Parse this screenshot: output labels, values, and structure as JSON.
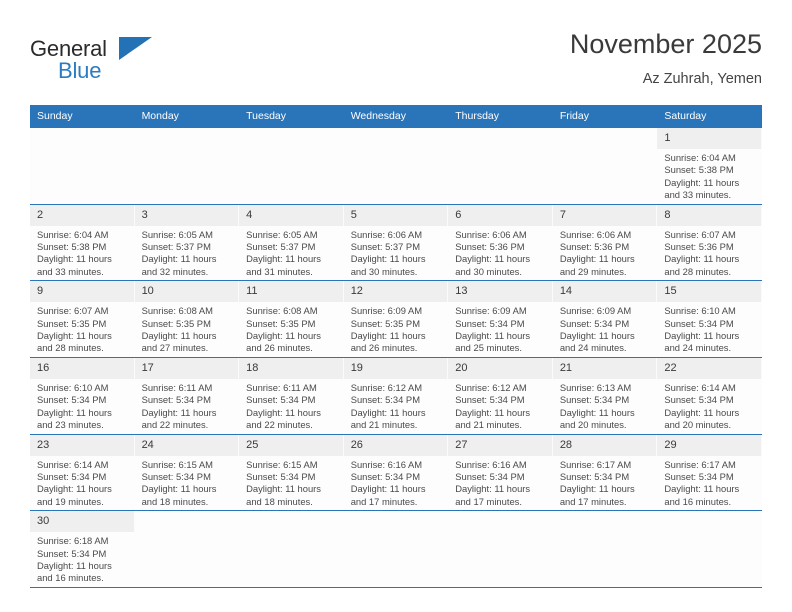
{
  "brand": {
    "name_top": "General",
    "name_bottom": "Blue",
    "accent_color": "#2272b5"
  },
  "header": {
    "title": "November 2025",
    "subtitle": "Az Zuhrah, Yemen"
  },
  "calendar": {
    "header_bg": "#2a74b9",
    "daynum_bg": "#efefef",
    "weekday_headers": [
      "Sunday",
      "Monday",
      "Tuesday",
      "Wednesday",
      "Thursday",
      "Friday",
      "Saturday"
    ],
    "weeks": [
      [
        {
          "day": "",
          "blank": true,
          "lines": []
        },
        {
          "day": "",
          "blank": true,
          "lines": []
        },
        {
          "day": "",
          "blank": true,
          "lines": []
        },
        {
          "day": "",
          "blank": true,
          "lines": []
        },
        {
          "day": "",
          "blank": true,
          "lines": []
        },
        {
          "day": "",
          "blank": true,
          "lines": []
        },
        {
          "day": "1",
          "lines": [
            "Sunrise: 6:04 AM",
            "Sunset: 5:38 PM",
            "Daylight: 11 hours",
            "and 33 minutes."
          ]
        }
      ],
      [
        {
          "day": "2",
          "lines": [
            "Sunrise: 6:04 AM",
            "Sunset: 5:38 PM",
            "Daylight: 11 hours",
            "and 33 minutes."
          ]
        },
        {
          "day": "3",
          "lines": [
            "Sunrise: 6:05 AM",
            "Sunset: 5:37 PM",
            "Daylight: 11 hours",
            "and 32 minutes."
          ]
        },
        {
          "day": "4",
          "lines": [
            "Sunrise: 6:05 AM",
            "Sunset: 5:37 PM",
            "Daylight: 11 hours",
            "and 31 minutes."
          ]
        },
        {
          "day": "5",
          "lines": [
            "Sunrise: 6:06 AM",
            "Sunset: 5:37 PM",
            "Daylight: 11 hours",
            "and 30 minutes."
          ]
        },
        {
          "day": "6",
          "lines": [
            "Sunrise: 6:06 AM",
            "Sunset: 5:36 PM",
            "Daylight: 11 hours",
            "and 30 minutes."
          ]
        },
        {
          "day": "7",
          "lines": [
            "Sunrise: 6:06 AM",
            "Sunset: 5:36 PM",
            "Daylight: 11 hours",
            "and 29 minutes."
          ]
        },
        {
          "day": "8",
          "lines": [
            "Sunrise: 6:07 AM",
            "Sunset: 5:36 PM",
            "Daylight: 11 hours",
            "and 28 minutes."
          ]
        }
      ],
      [
        {
          "day": "9",
          "lines": [
            "Sunrise: 6:07 AM",
            "Sunset: 5:35 PM",
            "Daylight: 11 hours",
            "and 28 minutes."
          ]
        },
        {
          "day": "10",
          "lines": [
            "Sunrise: 6:08 AM",
            "Sunset: 5:35 PM",
            "Daylight: 11 hours",
            "and 27 minutes."
          ]
        },
        {
          "day": "11",
          "lines": [
            "Sunrise: 6:08 AM",
            "Sunset: 5:35 PM",
            "Daylight: 11 hours",
            "and 26 minutes."
          ]
        },
        {
          "day": "12",
          "lines": [
            "Sunrise: 6:09 AM",
            "Sunset: 5:35 PM",
            "Daylight: 11 hours",
            "and 26 minutes."
          ]
        },
        {
          "day": "13",
          "lines": [
            "Sunrise: 6:09 AM",
            "Sunset: 5:34 PM",
            "Daylight: 11 hours",
            "and 25 minutes."
          ]
        },
        {
          "day": "14",
          "lines": [
            "Sunrise: 6:09 AM",
            "Sunset: 5:34 PM",
            "Daylight: 11 hours",
            "and 24 minutes."
          ]
        },
        {
          "day": "15",
          "lines": [
            "Sunrise: 6:10 AM",
            "Sunset: 5:34 PM",
            "Daylight: 11 hours",
            "and 24 minutes."
          ]
        }
      ],
      [
        {
          "day": "16",
          "lines": [
            "Sunrise: 6:10 AM",
            "Sunset: 5:34 PM",
            "Daylight: 11 hours",
            "and 23 minutes."
          ]
        },
        {
          "day": "17",
          "lines": [
            "Sunrise: 6:11 AM",
            "Sunset: 5:34 PM",
            "Daylight: 11 hours",
            "and 22 minutes."
          ]
        },
        {
          "day": "18",
          "lines": [
            "Sunrise: 6:11 AM",
            "Sunset: 5:34 PM",
            "Daylight: 11 hours",
            "and 22 minutes."
          ]
        },
        {
          "day": "19",
          "lines": [
            "Sunrise: 6:12 AM",
            "Sunset: 5:34 PM",
            "Daylight: 11 hours",
            "and 21 minutes."
          ]
        },
        {
          "day": "20",
          "lines": [
            "Sunrise: 6:12 AM",
            "Sunset: 5:34 PM",
            "Daylight: 11 hours",
            "and 21 minutes."
          ]
        },
        {
          "day": "21",
          "lines": [
            "Sunrise: 6:13 AM",
            "Sunset: 5:34 PM",
            "Daylight: 11 hours",
            "and 20 minutes."
          ]
        },
        {
          "day": "22",
          "lines": [
            "Sunrise: 6:14 AM",
            "Sunset: 5:34 PM",
            "Daylight: 11 hours",
            "and 20 minutes."
          ]
        }
      ],
      [
        {
          "day": "23",
          "lines": [
            "Sunrise: 6:14 AM",
            "Sunset: 5:34 PM",
            "Daylight: 11 hours",
            "and 19 minutes."
          ]
        },
        {
          "day": "24",
          "lines": [
            "Sunrise: 6:15 AM",
            "Sunset: 5:34 PM",
            "Daylight: 11 hours",
            "and 18 minutes."
          ]
        },
        {
          "day": "25",
          "lines": [
            "Sunrise: 6:15 AM",
            "Sunset: 5:34 PM",
            "Daylight: 11 hours",
            "and 18 minutes."
          ]
        },
        {
          "day": "26",
          "lines": [
            "Sunrise: 6:16 AM",
            "Sunset: 5:34 PM",
            "Daylight: 11 hours",
            "and 17 minutes."
          ]
        },
        {
          "day": "27",
          "lines": [
            "Sunrise: 6:16 AM",
            "Sunset: 5:34 PM",
            "Daylight: 11 hours",
            "and 17 minutes."
          ]
        },
        {
          "day": "28",
          "lines": [
            "Sunrise: 6:17 AM",
            "Sunset: 5:34 PM",
            "Daylight: 11 hours",
            "and 17 minutes."
          ]
        },
        {
          "day": "29",
          "lines": [
            "Sunrise: 6:17 AM",
            "Sunset: 5:34 PM",
            "Daylight: 11 hours",
            "and 16 minutes."
          ]
        }
      ],
      [
        {
          "day": "30",
          "lines": [
            "Sunrise: 6:18 AM",
            "Sunset: 5:34 PM",
            "Daylight: 11 hours",
            "and 16 minutes."
          ]
        },
        {
          "day": "",
          "blank": true,
          "lines": []
        },
        {
          "day": "",
          "blank": true,
          "lines": []
        },
        {
          "day": "",
          "blank": true,
          "lines": []
        },
        {
          "day": "",
          "blank": true,
          "lines": []
        },
        {
          "day": "",
          "blank": true,
          "lines": []
        },
        {
          "day": "",
          "blank": true,
          "lines": []
        }
      ]
    ]
  }
}
